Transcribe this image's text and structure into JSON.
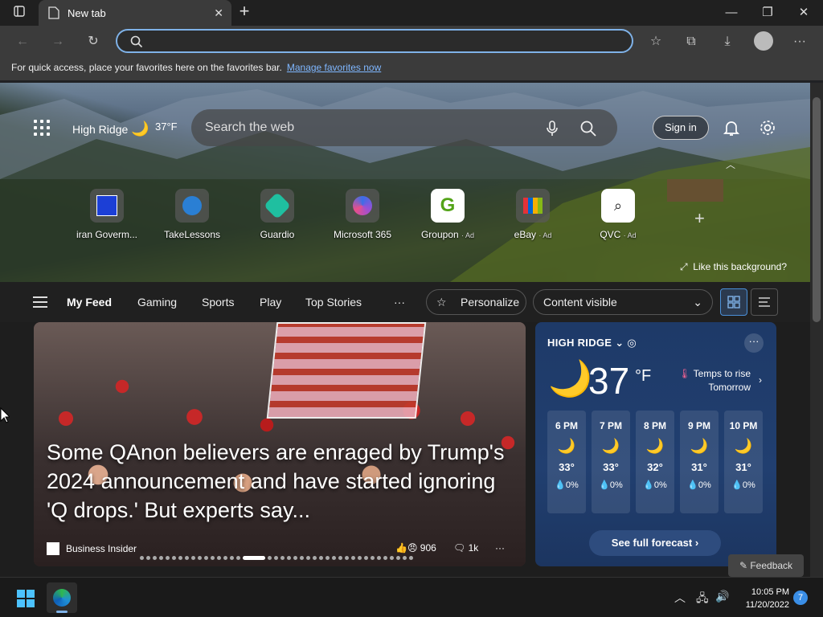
{
  "tab": {
    "title": "New tab"
  },
  "favbar": {
    "text": "For quick access, place your favorites here on the favorites bar.",
    "link": "Manage favorites now"
  },
  "header": {
    "location": "High Ridge",
    "temp": "37°F",
    "search_placeholder": "Search the web",
    "sign_in": "Sign in"
  },
  "tiles": [
    {
      "label": "iran Goverm...",
      "ad": ""
    },
    {
      "label": "TakeLessons",
      "ad": ""
    },
    {
      "label": "Guardio",
      "ad": ""
    },
    {
      "label": "Microsoft 365",
      "ad": ""
    },
    {
      "label": "Groupon",
      "ad": "· Ad"
    },
    {
      "label": "eBay",
      "ad": "· Ad"
    },
    {
      "label": "QVC",
      "ad": "· Ad"
    }
  ],
  "like_bg": "Like this background?",
  "feed": {
    "tabs": [
      "My Feed",
      "Gaming",
      "Sports",
      "Play",
      "Top Stories"
    ],
    "more": "···",
    "personalize": "Personalize",
    "content_visible": "Content visible"
  },
  "article": {
    "headline": "Some QAnon believers are enraged by Trump's 2024 announcement and have started ignoring 'Q drops.' But experts say...",
    "source": "Business Insider",
    "reactions": "906",
    "comments": "1k"
  },
  "weather": {
    "location": "HIGH RIDGE",
    "temp": "37",
    "unit": "°F",
    "alert_line1": "Temps to rise",
    "alert_line2": "Tomorrow",
    "hours": [
      {
        "time": "6 PM",
        "temp": "33°",
        "precip": "0%"
      },
      {
        "time": "7 PM",
        "temp": "33°",
        "precip": "0%"
      },
      {
        "time": "8 PM",
        "temp": "32°",
        "precip": "0%"
      },
      {
        "time": "9 PM",
        "temp": "31°",
        "precip": "0%"
      },
      {
        "time": "10 PM",
        "temp": "31°",
        "precip": "0%"
      }
    ],
    "forecast_btn": "See full forecast"
  },
  "feedback": "Feedback",
  "taskbar": {
    "time": "10:05 PM",
    "date": "11/20/2022",
    "notifications": "7"
  },
  "colors": {
    "accent": "#7fb2e8",
    "link": "#7fb7ff",
    "weather_bg": "#1e3a68",
    "moon": "#f0b830"
  }
}
